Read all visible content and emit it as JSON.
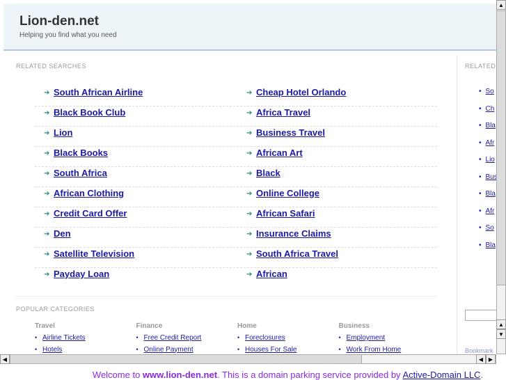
{
  "header": {
    "title": "Lion-den.net",
    "tagline": "Helping you find what you need"
  },
  "related": {
    "heading": "RELATED SEARCHES",
    "col1": [
      "South African Airline",
      "Black Book Club",
      "Lion",
      "Black Books",
      "South Africa",
      "African Clothing",
      "Credit Card Offer",
      "Den",
      "Satellite Television",
      "Payday Loan"
    ],
    "col2": [
      "Cheap Hotel Orlando",
      "Africa Travel",
      "Business Travel",
      "African Art",
      "Black",
      "Online College",
      "African Safari",
      "Insurance Claims",
      "South Africa Travel",
      "African"
    ]
  },
  "sidebar": {
    "heading": "RELATED",
    "items": [
      "So",
      "Ch",
      "Bla",
      "Afr",
      "Lio",
      "Bus",
      "Bla",
      "Afr",
      "So",
      "Bla"
    ],
    "bookmark": "Bookmark"
  },
  "popular": {
    "heading": "POPULAR CATEGORIES",
    "cats": [
      {
        "name": "Travel",
        "links": [
          "Airline Tickets",
          "Hotels"
        ]
      },
      {
        "name": "Finance",
        "links": [
          "Free Credit Report",
          "Online Payment"
        ]
      },
      {
        "name": "Home",
        "links": [
          "Foreclosures",
          "Houses For Sale"
        ]
      },
      {
        "name": "Business",
        "links": [
          "Employment",
          "Work From Home"
        ]
      }
    ]
  },
  "footer": {
    "pre": "Welcome to ",
    "domain": "www.lion-den.net",
    "mid": ". This is a domain parking service provided by ",
    "link": "Active-Domain LLC",
    "post": "."
  }
}
